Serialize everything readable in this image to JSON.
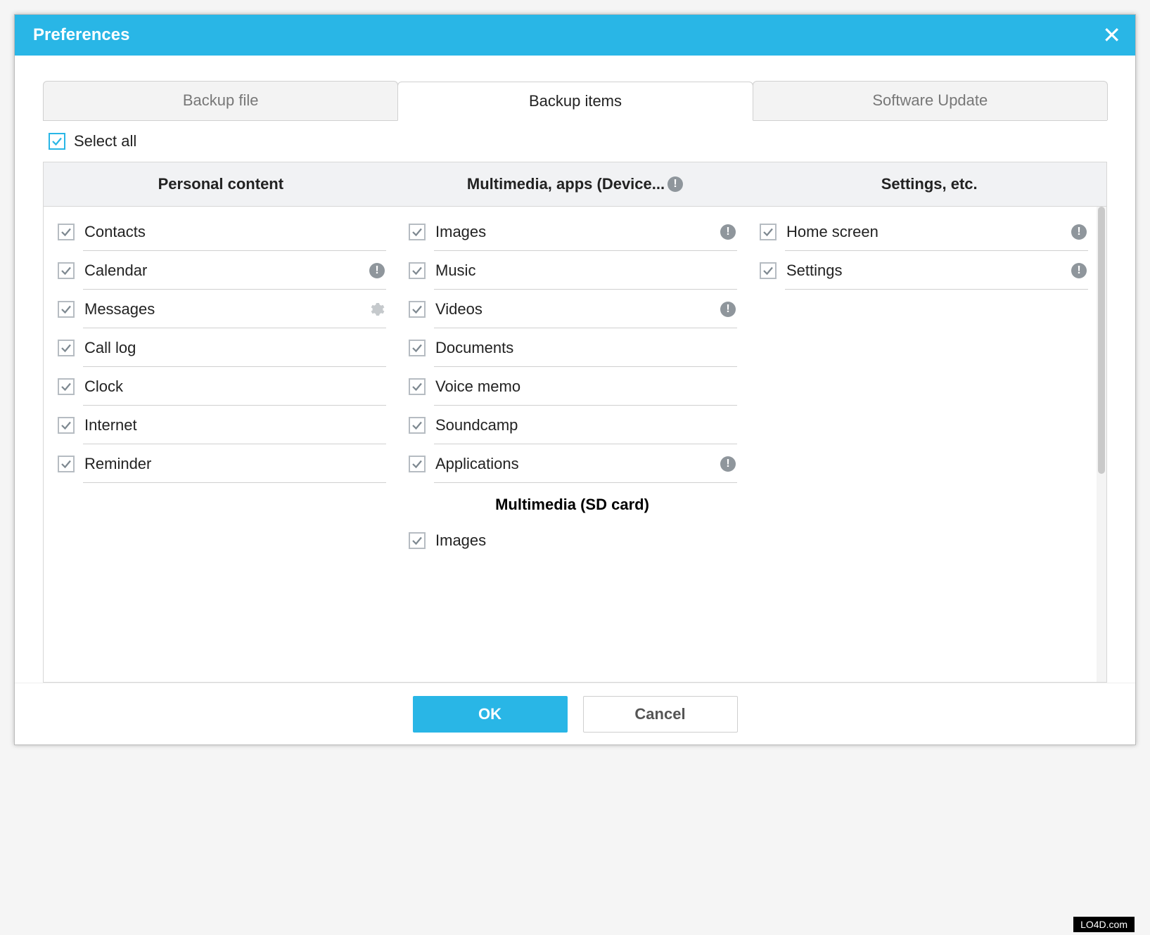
{
  "titlebar": {
    "title": "Preferences"
  },
  "tabs": {
    "backup_file": "Backup file",
    "backup_items": "Backup items",
    "software_update": "Software Update",
    "active": "backup_items"
  },
  "select_all": {
    "label": "Select all",
    "checked": true
  },
  "columns": {
    "personal": {
      "header": "Personal content",
      "items": [
        {
          "label": "Contacts",
          "checked": true
        },
        {
          "label": "Calendar",
          "checked": true,
          "info": true
        },
        {
          "label": "Messages",
          "checked": true,
          "gear": true
        },
        {
          "label": "Call log",
          "checked": true
        },
        {
          "label": "Clock",
          "checked": true
        },
        {
          "label": "Internet",
          "checked": true
        },
        {
          "label": "Reminder",
          "checked": true
        }
      ]
    },
    "multimedia": {
      "header": "Multimedia, apps (Device...",
      "items": [
        {
          "label": "Images",
          "checked": true,
          "info": true
        },
        {
          "label": "Music",
          "checked": true
        },
        {
          "label": "Videos",
          "checked": true,
          "info": true
        },
        {
          "label": "Documents",
          "checked": true
        },
        {
          "label": "Voice memo",
          "checked": true
        },
        {
          "label": "Soundcamp",
          "checked": true
        },
        {
          "label": "Applications",
          "checked": true,
          "info": true
        }
      ],
      "subheader": "Multimedia (SD card)",
      "sub_items": [
        {
          "label": "Images",
          "checked": true
        }
      ]
    },
    "settings": {
      "header": "Settings, etc.",
      "items": [
        {
          "label": "Home screen",
          "checked": true,
          "info": true
        },
        {
          "label": "Settings",
          "checked": true,
          "info": true
        }
      ]
    }
  },
  "buttons": {
    "ok": "OK",
    "cancel": "Cancel"
  },
  "watermark": "LO4D.com"
}
